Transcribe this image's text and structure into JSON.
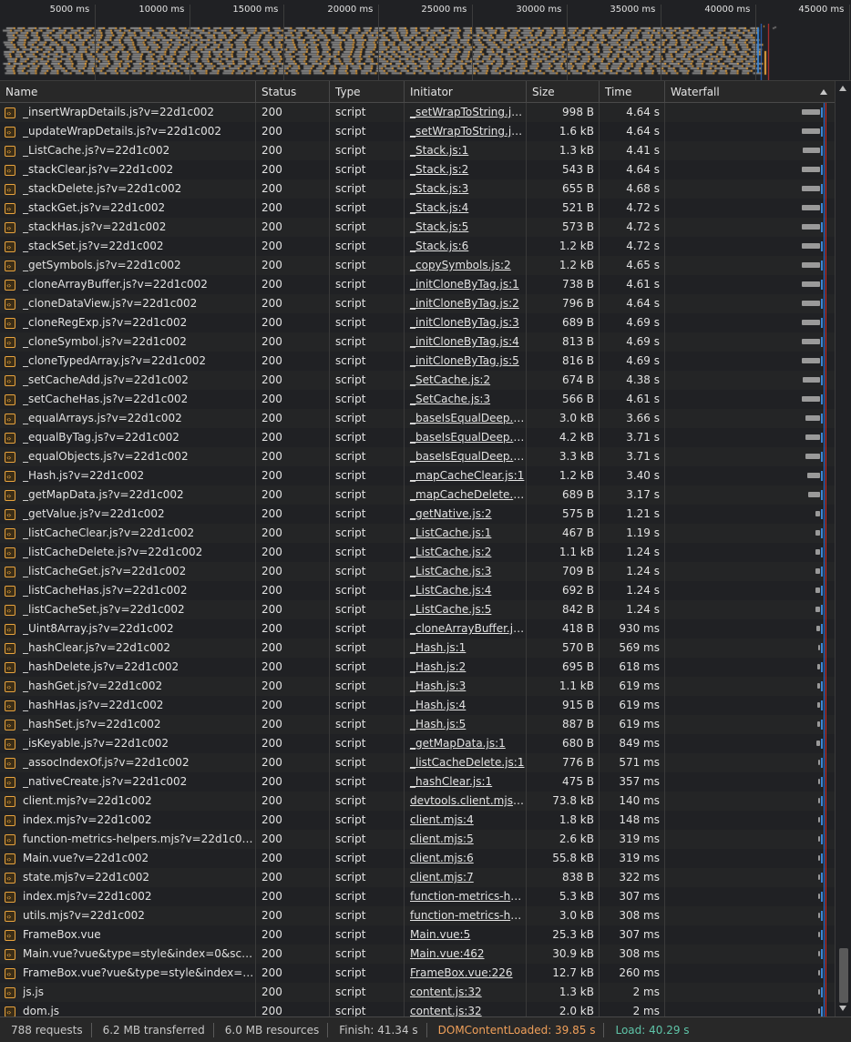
{
  "overview": {
    "ticks": [
      "5000 ms",
      "10000 ms",
      "15000 ms",
      "20000 ms",
      "25000 ms",
      "30000 ms",
      "35000 ms",
      "40000 ms",
      "45000 ms"
    ]
  },
  "columns": {
    "name": "Name",
    "status": "Status",
    "type": "Type",
    "initiator": "Initiator",
    "size": "Size",
    "time": "Time",
    "waterfall": "Waterfall"
  },
  "rows": [
    {
      "name": "_insertWrapDetails.js?v=22d1c002",
      "status": "200",
      "type": "script",
      "initiator": "_setWrapToString.js:2",
      "size": "998 B",
      "time": "4.64 s"
    },
    {
      "name": "_updateWrapDetails.js?v=22d1c002",
      "status": "200",
      "type": "script",
      "initiator": "_setWrapToString.js:4",
      "size": "1.6 kB",
      "time": "4.64 s"
    },
    {
      "name": "_ListCache.js?v=22d1c002",
      "status": "200",
      "type": "script",
      "initiator": "_Stack.js:1",
      "size": "1.3 kB",
      "time": "4.41 s"
    },
    {
      "name": "_stackClear.js?v=22d1c002",
      "status": "200",
      "type": "script",
      "initiator": "_Stack.js:2",
      "size": "543 B",
      "time": "4.64 s"
    },
    {
      "name": "_stackDelete.js?v=22d1c002",
      "status": "200",
      "type": "script",
      "initiator": "_Stack.js:3",
      "size": "655 B",
      "time": "4.68 s"
    },
    {
      "name": "_stackGet.js?v=22d1c002",
      "status": "200",
      "type": "script",
      "initiator": "_Stack.js:4",
      "size": "521 B",
      "time": "4.72 s"
    },
    {
      "name": "_stackHas.js?v=22d1c002",
      "status": "200",
      "type": "script",
      "initiator": "_Stack.js:5",
      "size": "573 B",
      "time": "4.72 s"
    },
    {
      "name": "_stackSet.js?v=22d1c002",
      "status": "200",
      "type": "script",
      "initiator": "_Stack.js:6",
      "size": "1.2 kB",
      "time": "4.72 s"
    },
    {
      "name": "_getSymbols.js?v=22d1c002",
      "status": "200",
      "type": "script",
      "initiator": "_copySymbols.js:2",
      "size": "1.2 kB",
      "time": "4.65 s"
    },
    {
      "name": "_cloneArrayBuffer.js?v=22d1c002",
      "status": "200",
      "type": "script",
      "initiator": "_initCloneByTag.js:1",
      "size": "738 B",
      "time": "4.61 s"
    },
    {
      "name": "_cloneDataView.js?v=22d1c002",
      "status": "200",
      "type": "script",
      "initiator": "_initCloneByTag.js:2",
      "size": "796 B",
      "time": "4.64 s"
    },
    {
      "name": "_cloneRegExp.js?v=22d1c002",
      "status": "200",
      "type": "script",
      "initiator": "_initCloneByTag.js:3",
      "size": "689 B",
      "time": "4.69 s"
    },
    {
      "name": "_cloneSymbol.js?v=22d1c002",
      "status": "200",
      "type": "script",
      "initiator": "_initCloneByTag.js:4",
      "size": "813 B",
      "time": "4.69 s"
    },
    {
      "name": "_cloneTypedArray.js?v=22d1c002",
      "status": "200",
      "type": "script",
      "initiator": "_initCloneByTag.js:5",
      "size": "816 B",
      "time": "4.69 s"
    },
    {
      "name": "_setCacheAdd.js?v=22d1c002",
      "status": "200",
      "type": "script",
      "initiator": "_SetCache.js:2",
      "size": "674 B",
      "time": "4.38 s"
    },
    {
      "name": "_setCacheHas.js?v=22d1c002",
      "status": "200",
      "type": "script",
      "initiator": "_SetCache.js:3",
      "size": "566 B",
      "time": "4.61 s"
    },
    {
      "name": "_equalArrays.js?v=22d1c002",
      "status": "200",
      "type": "script",
      "initiator": "_baseIsEqualDeep.js:2",
      "size": "3.0 kB",
      "time": "3.66 s"
    },
    {
      "name": "_equalByTag.js?v=22d1c002",
      "status": "200",
      "type": "script",
      "initiator": "_baseIsEqualDeep.js:3",
      "size": "4.2 kB",
      "time": "3.71 s"
    },
    {
      "name": "_equalObjects.js?v=22d1c002",
      "status": "200",
      "type": "script",
      "initiator": "_baseIsEqualDeep.js:4",
      "size": "3.3 kB",
      "time": "3.71 s"
    },
    {
      "name": "_Hash.js?v=22d1c002",
      "status": "200",
      "type": "script",
      "initiator": "_mapCacheClear.js:1",
      "size": "1.2 kB",
      "time": "3.40 s"
    },
    {
      "name": "_getMapData.js?v=22d1c002",
      "status": "200",
      "type": "script",
      "initiator": "_mapCacheDelete.js:1",
      "size": "689 B",
      "time": "3.17 s"
    },
    {
      "name": "_getValue.js?v=22d1c002",
      "status": "200",
      "type": "script",
      "initiator": "_getNative.js:2",
      "size": "575 B",
      "time": "1.21 s"
    },
    {
      "name": "_listCacheClear.js?v=22d1c002",
      "status": "200",
      "type": "script",
      "initiator": "_ListCache.js:1",
      "size": "467 B",
      "time": "1.19 s"
    },
    {
      "name": "_listCacheDelete.js?v=22d1c002",
      "status": "200",
      "type": "script",
      "initiator": "_ListCache.js:2",
      "size": "1.1 kB",
      "time": "1.24 s"
    },
    {
      "name": "_listCacheGet.js?v=22d1c002",
      "status": "200",
      "type": "script",
      "initiator": "_ListCache.js:3",
      "size": "709 B",
      "time": "1.24 s"
    },
    {
      "name": "_listCacheHas.js?v=22d1c002",
      "status": "200",
      "type": "script",
      "initiator": "_ListCache.js:4",
      "size": "692 B",
      "time": "1.24 s"
    },
    {
      "name": "_listCacheSet.js?v=22d1c002",
      "status": "200",
      "type": "script",
      "initiator": "_ListCache.js:5",
      "size": "842 B",
      "time": "1.24 s"
    },
    {
      "name": "_Uint8Array.js?v=22d1c002",
      "status": "200",
      "type": "script",
      "initiator": "_cloneArrayBuffer.js:1",
      "size": "418 B",
      "time": "930 ms"
    },
    {
      "name": "_hashClear.js?v=22d1c002",
      "status": "200",
      "type": "script",
      "initiator": "_Hash.js:1",
      "size": "570 B",
      "time": "569 ms"
    },
    {
      "name": "_hashDelete.js?v=22d1c002",
      "status": "200",
      "type": "script",
      "initiator": "_Hash.js:2",
      "size": "695 B",
      "time": "618 ms"
    },
    {
      "name": "_hashGet.js?v=22d1c002",
      "status": "200",
      "type": "script",
      "initiator": "_Hash.js:3",
      "size": "1.1 kB",
      "time": "619 ms"
    },
    {
      "name": "_hashHas.js?v=22d1c002",
      "status": "200",
      "type": "script",
      "initiator": "_Hash.js:4",
      "size": "915 B",
      "time": "619 ms"
    },
    {
      "name": "_hashSet.js?v=22d1c002",
      "status": "200",
      "type": "script",
      "initiator": "_Hash.js:5",
      "size": "887 B",
      "time": "619 ms"
    },
    {
      "name": "_isKeyable.js?v=22d1c002",
      "status": "200",
      "type": "script",
      "initiator": "_getMapData.js:1",
      "size": "680 B",
      "time": "849 ms"
    },
    {
      "name": "_assocIndexOf.js?v=22d1c002",
      "status": "200",
      "type": "script",
      "initiator": "_listCacheDelete.js:1",
      "size": "776 B",
      "time": "571 ms"
    },
    {
      "name": "_nativeCreate.js?v=22d1c002",
      "status": "200",
      "type": "script",
      "initiator": "_hashClear.js:1",
      "size": "475 B",
      "time": "357 ms"
    },
    {
      "name": "client.mjs?v=22d1c002",
      "status": "200",
      "type": "script",
      "initiator": "devtools.client.mjs?v=...",
      "size": "73.8 kB",
      "time": "140 ms"
    },
    {
      "name": "index.mjs?v=22d1c002",
      "status": "200",
      "type": "script",
      "initiator": "client.mjs:4",
      "size": "1.8 kB",
      "time": "148 ms"
    },
    {
      "name": "function-metrics-helpers.mjs?v=22d1c002",
      "status": "200",
      "type": "script",
      "initiator": "client.mjs:5",
      "size": "2.6 kB",
      "time": "319 ms"
    },
    {
      "name": "Main.vue?v=22d1c002",
      "status": "200",
      "type": "script",
      "initiator": "client.mjs:6",
      "size": "55.8 kB",
      "time": "319 ms"
    },
    {
      "name": "state.mjs?v=22d1c002",
      "status": "200",
      "type": "script",
      "initiator": "client.mjs:7",
      "size": "838 B",
      "time": "322 ms"
    },
    {
      "name": "index.mjs?v=22d1c002",
      "status": "200",
      "type": "script",
      "initiator": "function-metrics-help...",
      "size": "5.3 kB",
      "time": "307 ms"
    },
    {
      "name": "utils.mjs?v=22d1c002",
      "status": "200",
      "type": "script",
      "initiator": "function-metrics-help...",
      "size": "3.0 kB",
      "time": "308 ms"
    },
    {
      "name": "FrameBox.vue",
      "status": "200",
      "type": "script",
      "initiator": "Main.vue:5",
      "size": "25.3 kB",
      "time": "307 ms"
    },
    {
      "name": "Main.vue?vue&type=style&index=0&scoped...",
      "status": "200",
      "type": "script",
      "initiator": "Main.vue:462",
      "size": "30.9 kB",
      "time": "308 ms"
    },
    {
      "name": "FrameBox.vue?vue&type=style&index=0&sco...",
      "status": "200",
      "type": "script",
      "initiator": "FrameBox.vue:226",
      "size": "12.7 kB",
      "time": "260 ms"
    },
    {
      "name": "js.js",
      "status": "200",
      "type": "script",
      "initiator": "content.js:32",
      "size": "1.3 kB",
      "time": "2 ms"
    },
    {
      "name": "dom.js",
      "status": "200",
      "type": "script",
      "initiator": "content.js:32",
      "size": "2.0 kB",
      "time": "2 ms"
    }
  ],
  "statusbar": {
    "requests": "788 requests",
    "transferred": "6.2 MB transferred",
    "resources": "6.0 MB resources",
    "finish": "Finish: 41.34 s",
    "dcl": "DOMContentLoaded: 39.85 s",
    "load": "Load: 40.29 s"
  },
  "colors": {
    "dcl": "#f0a05a",
    "load": "#5fc4a8",
    "script_icon": "#e8a33d",
    "waiting": "#9a9a9a",
    "receiving": "#3a86d6"
  }
}
